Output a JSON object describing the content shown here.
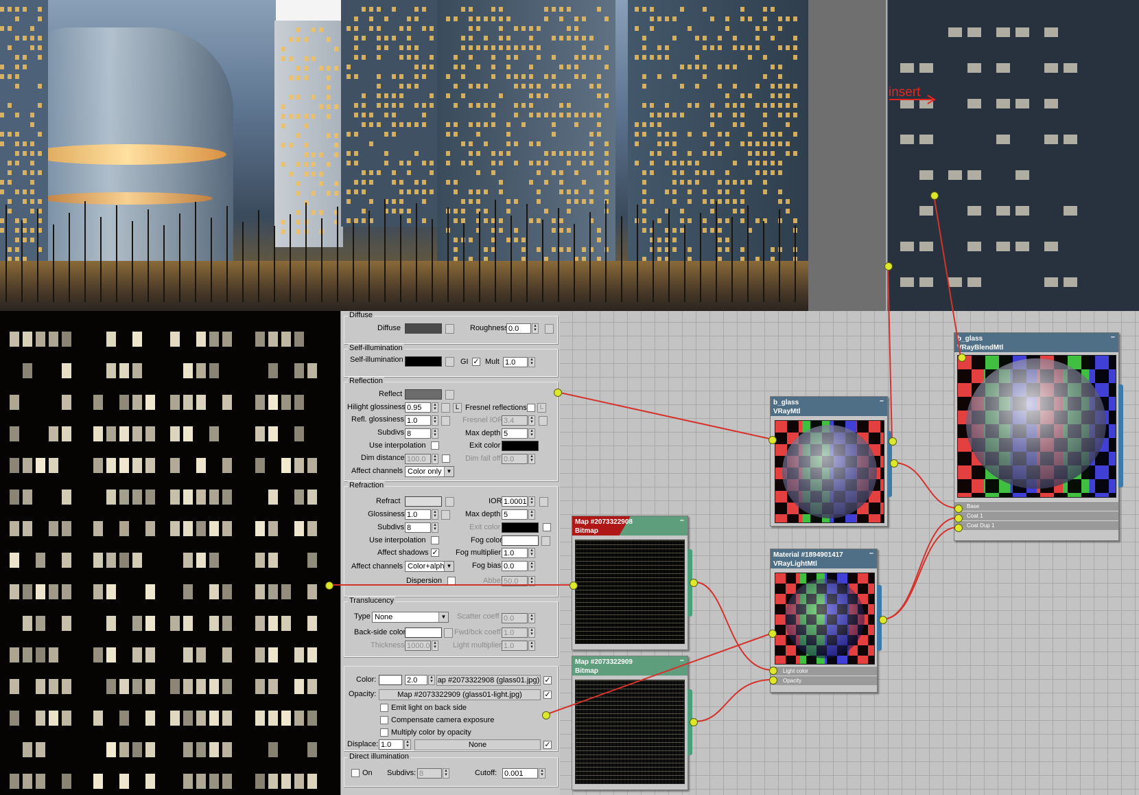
{
  "render": {
    "insert_label": "insert"
  },
  "panel": {
    "diffuse": {
      "title": "Diffuse",
      "diffuse_label": "Diffuse",
      "roughness_label": "Roughness",
      "roughness": "0.0",
      "diffuse_color": "#4a4a4a"
    },
    "self_illum": {
      "title": "Self-illumination",
      "label": "Self-illumination",
      "gi_label": "GI",
      "gi_checked": "✓",
      "mult_label": "Mult",
      "mult": "1.0",
      "color": "#000000"
    },
    "reflection": {
      "title": "Reflection",
      "reflect_label": "Reflect",
      "reflect_color": "#6c6c6c",
      "hilight_label": "Hilight glossiness",
      "hilight": "0.95",
      "l_btn": "L",
      "fresnel_label": "Fresnel reflections",
      "fresnel_l": "L",
      "refl_gloss_label": "Refl. glossiness",
      "refl_gloss": "1.0",
      "fresnel_ior_label": "Fresnel IOR",
      "fresnel_ior": "3.4",
      "subdivs_label": "Subdivs",
      "subdivs": "8",
      "max_depth_label": "Max depth",
      "max_depth": "5",
      "use_interp_label": "Use interpolation",
      "exit_color_label": "Exit color",
      "exit_color": "#000000",
      "dim_dist_label": "Dim distance",
      "dim_dist": "100.0",
      "dim_falloff_label": "Dim fall off",
      "dim_falloff": "0.0",
      "affect_label": "Affect channels",
      "affect": "Color only"
    },
    "refraction": {
      "title": "Refraction",
      "refract_label": "Refract",
      "refract_color": "#dcdcdc",
      "ior_label": "IOR",
      "ior": "1.0001",
      "gloss_label": "Glossiness",
      "gloss": "1.0",
      "max_depth_label": "Max depth",
      "max_depth": "5",
      "subdivs_label": "Subdivs",
      "subdivs": "8",
      "exit_color_label": "Exit color",
      "exit_color": "#000000",
      "use_interp_label": "Use interpolation",
      "fog_color_label": "Fog color",
      "fog_color": "#ffffff",
      "affect_shadows_label": "Affect shadows",
      "affect_shadows_checked": "✓",
      "fog_mult_label": "Fog multiplier",
      "fog_mult": "1.0",
      "affect_label": "Affect channels",
      "affect": "Color+alpha",
      "fog_bias_label": "Fog bias",
      "fog_bias": "0.0",
      "dispersion_label": "Dispersion",
      "abbe_label": "Abbe",
      "abbe": "50.0"
    },
    "translucency": {
      "title": "Translucency",
      "type_label": "Type",
      "type": "None",
      "scatter_label": "Scatter coeff",
      "scatter": "0.0",
      "backside_label": "Back-side color",
      "backside_color": "#ffffff",
      "fwd_label": "Fwd/bck coeff",
      "fwd": "1.0",
      "thickness_label": "Thickness",
      "thickness": "1000.0",
      "light_mult_label": "Light multiplier",
      "light_mult": "1.0"
    },
    "light": {
      "color_label": "Color:",
      "color_value": "2.0",
      "color_swatch": "#ffffff",
      "color_map": "ap #2073322908 (glass01.jpg)",
      "opacity_label": "Opacity:",
      "opacity_map": "Map #2073322909 (glass01-light.jpg)",
      "check_mark": "✓",
      "emit_back_label": "Emit light on back side",
      "compensate_label": "Compensate camera exposure",
      "multiply_label": "Multiply color by opacity",
      "displace_label": "Displace:",
      "displace": "1.0",
      "displace_map": "None",
      "direct_title": "Direct illumination",
      "on_label": "On",
      "subdivs_label": "Subdivs:",
      "subdivs": "8",
      "cutoff_label": "Cutoff:",
      "cutoff": "0.001"
    }
  },
  "nodes": {
    "b_glass_vray": {
      "name": "b_glass",
      "type": "VRayMtl"
    },
    "b_glass_blend": {
      "name": "b_glass",
      "type": "VRayBlendMtl",
      "slots": [
        "Base",
        "Coat 1",
        "Coat Dup 1"
      ]
    },
    "map_908": {
      "name": "Map #2073322908",
      "type": "Bitmap"
    },
    "map_909": {
      "name": "Map #2073322909",
      "type": "Bitmap"
    },
    "light_mtl": {
      "name": "Material #1894901417",
      "type": "VRayLightMtl",
      "slots": [
        "Light color",
        "Opacity"
      ]
    },
    "minimize": "–"
  },
  "colors": {
    "wire": "#d4322a",
    "port": "#dde82a",
    "node_header_blue": "#4f6f86",
    "node_header_green": "#5e9e7c",
    "node_header_red": "#b01818"
  }
}
